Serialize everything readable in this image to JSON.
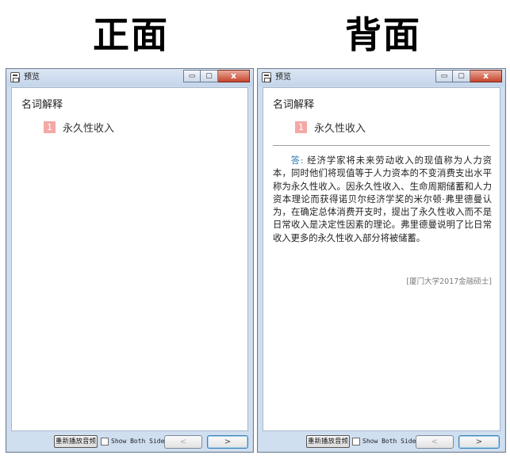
{
  "headings": {
    "front": "正面",
    "back": "背面"
  },
  "window": {
    "title": "预览",
    "controls": {
      "minimize": "▭",
      "maximize": "▢",
      "close": "x"
    }
  },
  "card": {
    "section_title": "名词解释",
    "term_number": "1",
    "term": "永久性收入",
    "answer_label": "答:",
    "answer_text": "经济学家将未来劳动收入的现值称为人力资本，同时他们将现值等于人力资本的不变消费支出水平称为永久性收入。因永久性收入、生命周期储蓄和人力资本理论而获得诺贝尔经济学奖的米尔顿·弗里德曼认为，在确定总体消费开支时，提出了永久性收入而不是日常收入是决定性因素的理论。弗里德曼说明了比日常收入更多的永久性收入部分将被储蓄。",
    "source": "[厦门大学2017金融硕士]"
  },
  "bottombar": {
    "replay_label": "重新播放音频",
    "show_both_label": "Show Both Sides",
    "show_both_checked": false,
    "prev_label": "<",
    "next_label": ">"
  },
  "colors": {
    "term_badge": "#f3a9a5",
    "answer_label": "#2e7fb5",
    "close_button": "#c6452c"
  }
}
